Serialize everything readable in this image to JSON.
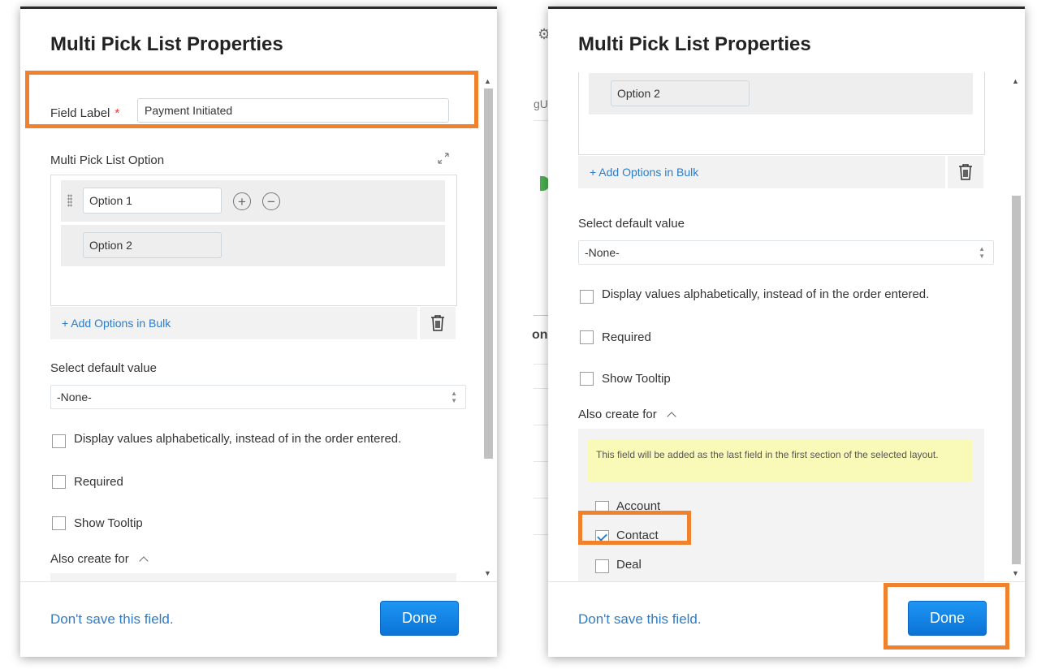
{
  "left_dialog": {
    "title": "Multi Pick List Properties",
    "field_label": {
      "label": "Field Label",
      "required_mark": "*",
      "value": "Payment Initiated"
    },
    "options_section": {
      "label": "Multi Pick List Option",
      "expand_icon": "expand-icon",
      "options": [
        "Option 1",
        "Option 2"
      ]
    },
    "add_bulk": "+ Add Options in Bulk",
    "default_value": {
      "label": "Select default value",
      "selected": "-None-"
    },
    "checkboxes": [
      {
        "label": "Display values alphabetically, instead of in the order entered.",
        "checked": false
      },
      {
        "label": "Required",
        "checked": false
      },
      {
        "label": "Show Tooltip",
        "checked": false
      }
    ],
    "also_create_for": "Also create for",
    "footer": {
      "dont_save": "Don't save this field.",
      "done": "Done"
    }
  },
  "right_dialog": {
    "title": "Multi Pick List Properties",
    "visible_option": "Option 2",
    "add_bulk": "+ Add Options in Bulk",
    "default_value": {
      "label": "Select default value",
      "selected": "-None-"
    },
    "checkboxes": [
      {
        "label": "Display values alphabetically, instead of in the order entered.",
        "checked": false
      },
      {
        "label": "Required",
        "checked": false
      },
      {
        "label": "Show Tooltip",
        "checked": false
      }
    ],
    "also_create_for": "Also create for",
    "note": "This field will be added as the last field in the first section of the selected layout.",
    "modules": [
      {
        "label": "Account",
        "checked": false
      },
      {
        "label": "Contact",
        "checked": true
      },
      {
        "label": "Deal",
        "checked": false
      }
    ],
    "footer": {
      "dont_save": "Don't save this field.",
      "done": "Done"
    }
  },
  "background": {
    "fragment_1": "gU",
    "fragment_2": "on"
  },
  "colors": {
    "accent": "#2f7cc7",
    "highlight": "#f0822d",
    "done_button": "#1d96f3",
    "note_bg": "#fafab8"
  }
}
